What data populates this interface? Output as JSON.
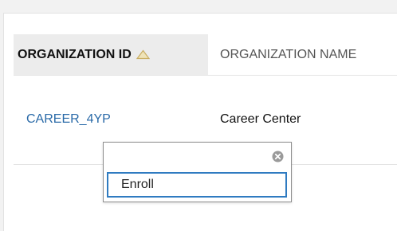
{
  "table": {
    "columns": [
      {
        "label": "ORGANIZATION ID",
        "sorted": "ascending",
        "sort_icon": "triangle-up-icon"
      },
      {
        "label": "ORGANIZATION NAME"
      }
    ],
    "rows": [
      {
        "organization_id": "CAREER_4YP",
        "organization_name": "Career Center"
      }
    ]
  },
  "context_menu": {
    "close_icon": "close-circle-icon",
    "items": [
      {
        "label": "Enroll"
      }
    ]
  },
  "colors": {
    "link": "#2a6aa8",
    "focus_border": "#2f7bc1",
    "sorted_header_bg": "#ececec",
    "sort_icon": "#d9c07a"
  }
}
